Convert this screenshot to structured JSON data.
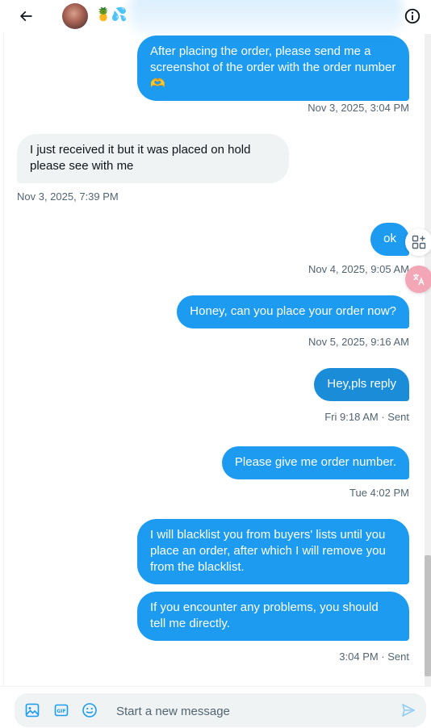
{
  "header": {
    "back_icon": "arrow-left-icon",
    "avatar_label": "avatar",
    "name_emoji": "🍍💦",
    "info_icon": "info-icon"
  },
  "messages": [
    {
      "dir": "out",
      "text": "After placing the order, please send me a screenshot of the order with the order number🫶",
      "meta": "Nov 3, 2025, 3:04 PM"
    },
    {
      "dir": "in",
      "text": "I just received it but it was placed on hold please see with me",
      "meta": "Nov 3, 2025, 7:39 PM"
    },
    {
      "dir": "out",
      "text": "ok",
      "meta": "Nov 4, 2025, 9:05 AM"
    },
    {
      "dir": "out",
      "text": "Honey, can you place your order now?",
      "meta": "Nov 5, 2025, 9:16 AM"
    },
    {
      "dir": "out",
      "text": "Hey,pls reply",
      "meta": "Fri 9:18 AM · Sent"
    },
    {
      "dir": "out",
      "text": "Please give me order number.",
      "meta": "Tue 4:02 PM"
    },
    {
      "dir": "out",
      "text": "I will blacklist you from buyers' lists until you place an order, after which I will remove you from the blacklist.",
      "meta": ""
    },
    {
      "dir": "out",
      "text": "If you encounter any problems, you should tell me directly.",
      "meta": "3:04 PM · Sent"
    }
  ],
  "composer": {
    "placeholder": "Start a new message",
    "media_icon": "image-icon",
    "gif_icon": "gif-icon",
    "emoji_icon": "emoji-icon",
    "send_icon": "send-icon"
  },
  "side_widgets": [
    "apps-icon",
    "translate-icon"
  ],
  "colors": {
    "accent": "#1d9bf0",
    "incoming_bg": "#eff3f4",
    "meta": "#536471"
  }
}
